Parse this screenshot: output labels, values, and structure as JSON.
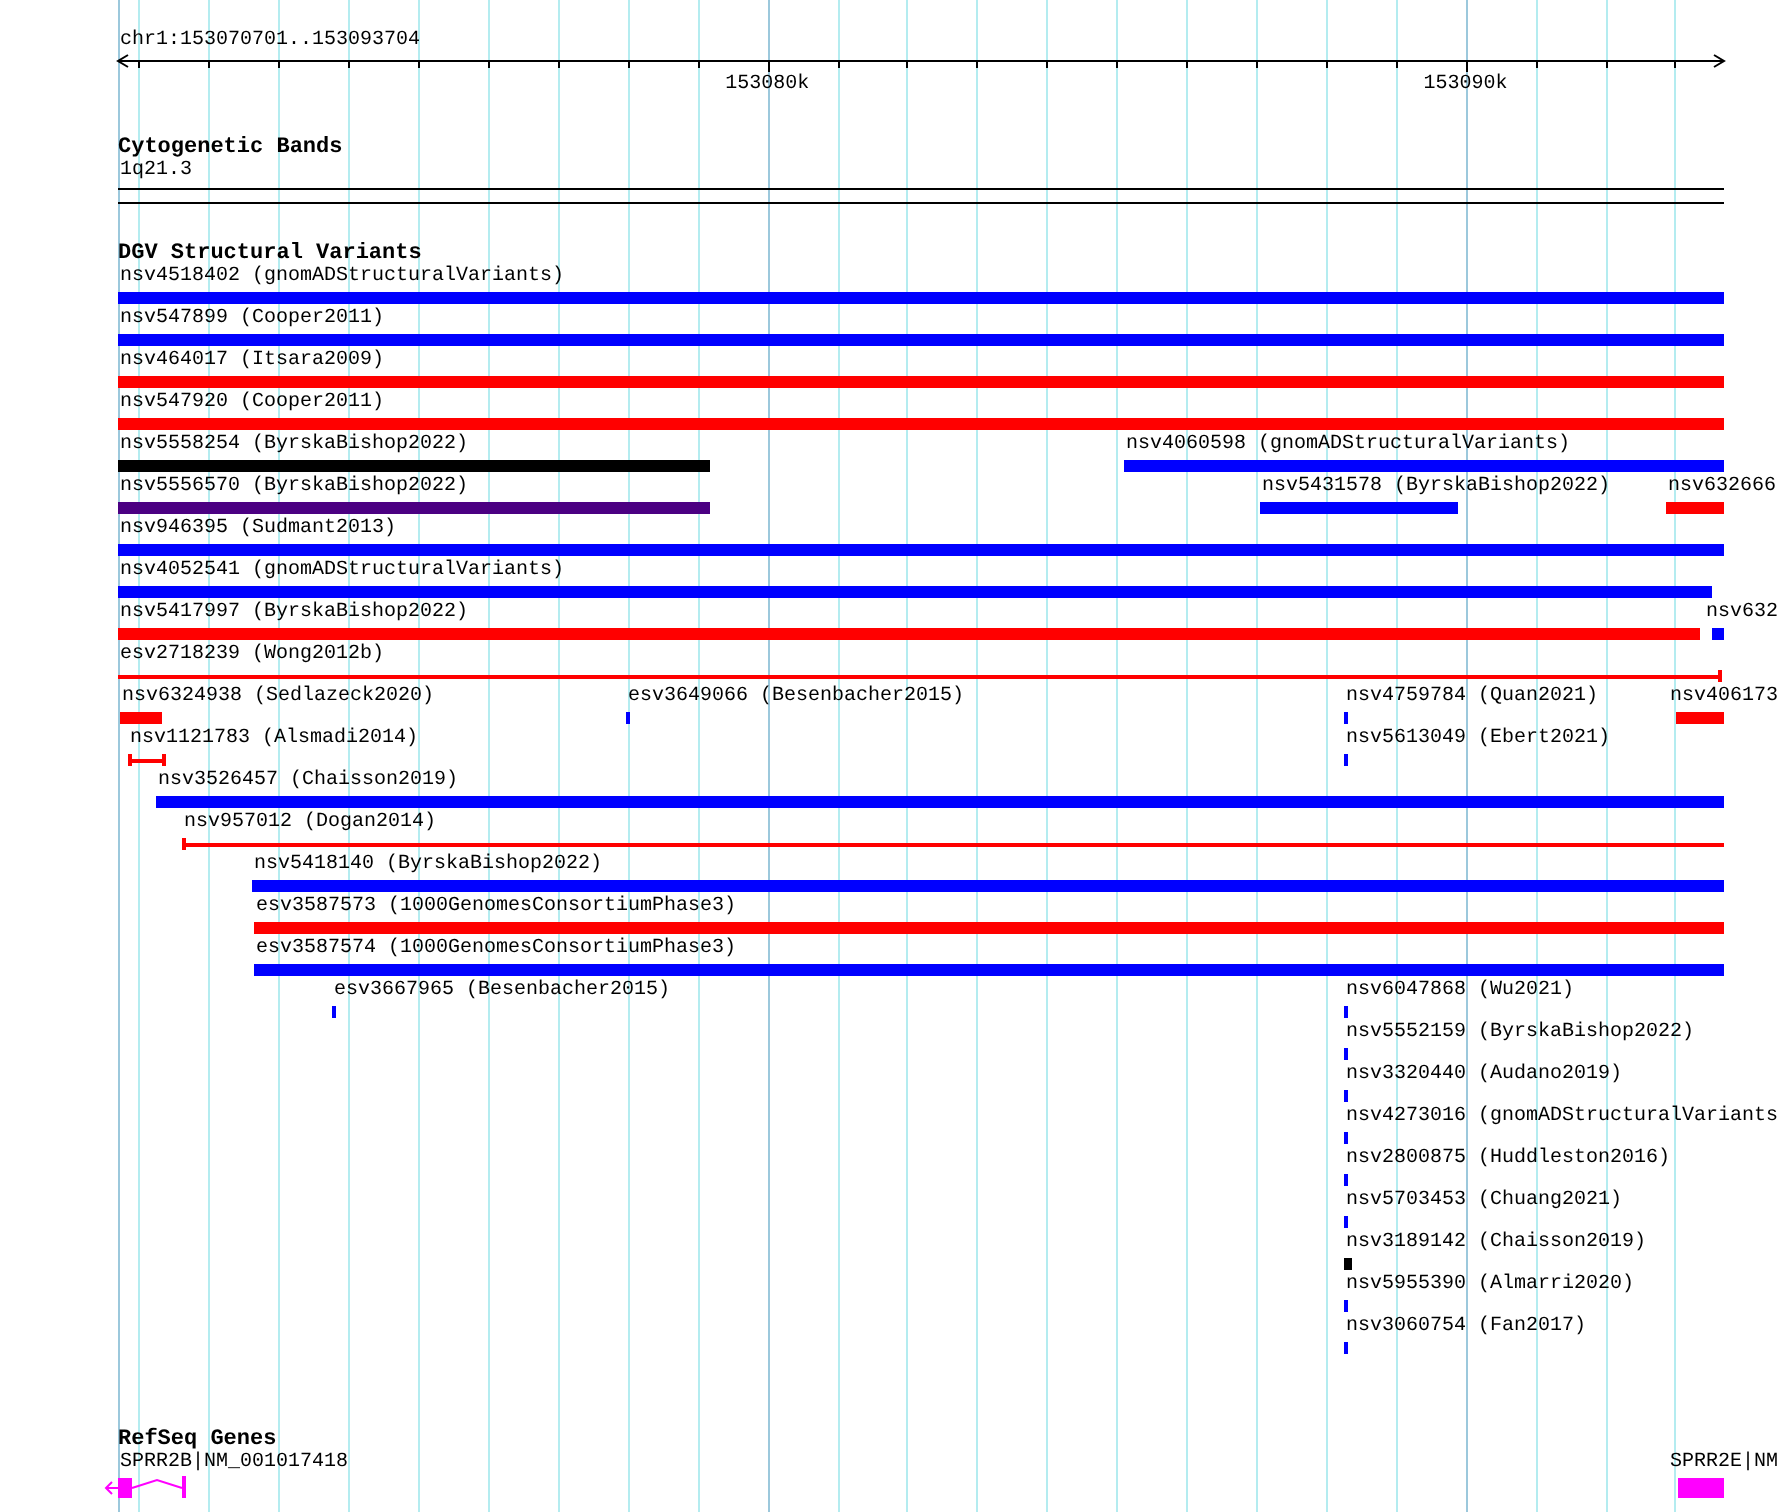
{
  "ruler": {
    "location": "chr1:153070701..153093704",
    "scale_labels": [
      "153080k",
      "153090k"
    ]
  },
  "cytogenetic_bands": {
    "title": "Cytogenetic Bands",
    "band": {
      "label": "1q21.3"
    }
  },
  "dgv_structural_variants": {
    "title": "DGV Structural Variants",
    "features": [
      {
        "label": "nsv4518402 (gnomADStructuralVariants)",
        "color": "#0000ff",
        "kind": "bar"
      },
      {
        "label": "nsv547899 (Cooper2011)",
        "color": "#0000ff",
        "kind": "bar"
      },
      {
        "label": "nsv464017 (Itsara2009)",
        "color": "#ff0000",
        "kind": "bar"
      },
      {
        "label": "nsv547920 (Cooper2011)",
        "color": "#ff0000",
        "kind": "bar"
      },
      {
        "label": "nsv5558254 (ByrskaBishop2022)",
        "color": "#000000",
        "kind": "bar"
      },
      {
        "label": "nsv4060598 (gnomADStructuralVariants)",
        "color": "#0000ff",
        "kind": "bar"
      },
      {
        "label": "nsv5556570 (ByrskaBishop2022)",
        "color": "#4b0082",
        "kind": "bar"
      },
      {
        "label": "nsv5431578 (ByrskaBishop2022)",
        "color": "#0000ff",
        "kind": "bar"
      },
      {
        "label": "nsv632666",
        "color": "#ff0000",
        "kind": "bar"
      },
      {
        "label": "nsv946395 (Sudmant2013)",
        "color": "#0000ff",
        "kind": "bar"
      },
      {
        "label": "nsv4052541 (gnomADStructuralVariants)",
        "color": "#0000ff",
        "kind": "bar"
      },
      {
        "label": "nsv5417997 (ByrskaBishop2022)",
        "color": "#ff0000",
        "kind": "bar"
      },
      {
        "label": "nsv632",
        "color": "#0000ff",
        "kind": "bar"
      },
      {
        "label": "esv2718239 (Wong2012b)",
        "color": "#ff0000",
        "kind": "line"
      },
      {
        "label": "nsv6324938 (Sedlazeck2020)",
        "color": "#ff0000",
        "kind": "bar"
      },
      {
        "label": "esv3649066 (Besenbacher2015)",
        "color": "#0000ff",
        "kind": "bar"
      },
      {
        "label": "nsv4759784 (Quan2021)",
        "color": "#0000ff",
        "kind": "bar"
      },
      {
        "label": "nsv406173",
        "color": "#ff0000",
        "kind": "bar"
      },
      {
        "label": "nsv1121783 (Alsmadi2014)",
        "color": "#ff0000",
        "kind": "line"
      },
      {
        "label": "nsv5613049 (Ebert2021)",
        "color": "#0000ff",
        "kind": "bar"
      },
      {
        "label": "nsv3526457 (Chaisson2019)",
        "color": "#0000ff",
        "kind": "bar"
      },
      {
        "label": "nsv957012 (Dogan2014)",
        "color": "#ff0000",
        "kind": "line"
      },
      {
        "label": "nsv5418140 (ByrskaBishop2022)",
        "color": "#0000ff",
        "kind": "bar"
      },
      {
        "label": "esv3587573 (1000GenomesConsortiumPhase3)",
        "color": "#ff0000",
        "kind": "bar"
      },
      {
        "label": "esv3587574 (1000GenomesConsortiumPhase3)",
        "color": "#0000ff",
        "kind": "bar"
      },
      {
        "label": "esv3667965 (Besenbacher2015)",
        "color": "#0000ff",
        "kind": "bar"
      },
      {
        "label": "nsv6047868 (Wu2021)",
        "color": "#0000ff",
        "kind": "bar"
      },
      {
        "label": "nsv5552159 (ByrskaBishop2022)",
        "color": "#0000ff",
        "kind": "bar"
      },
      {
        "label": "nsv3320440 (Audano2019)",
        "color": "#0000ff",
        "kind": "bar"
      },
      {
        "label": "nsv4273016 (gnomADStructuralVariants",
        "color": "#0000ff",
        "kind": "bar"
      },
      {
        "label": "nsv2800875 (Huddleston2016)",
        "color": "#0000ff",
        "kind": "bar"
      },
      {
        "label": "nsv5703453 (Chuang2021)",
        "color": "#0000ff",
        "kind": "bar"
      },
      {
        "label": "nsv3189142 (Chaisson2019)",
        "color": "#000000",
        "kind": "bar"
      },
      {
        "label": "nsv5955390 (Almarri2020)",
        "color": "#0000ff",
        "kind": "bar"
      },
      {
        "label": "nsv3060754 (Fan2017)",
        "color": "#0000ff",
        "kind": "bar"
      }
    ]
  },
  "refseq_genes": {
    "title": "RefSeq Genes",
    "genes": [
      {
        "label": "SPRR2B|NM_001017418"
      },
      {
        "label": "SPRR2E|NM"
      }
    ]
  }
}
